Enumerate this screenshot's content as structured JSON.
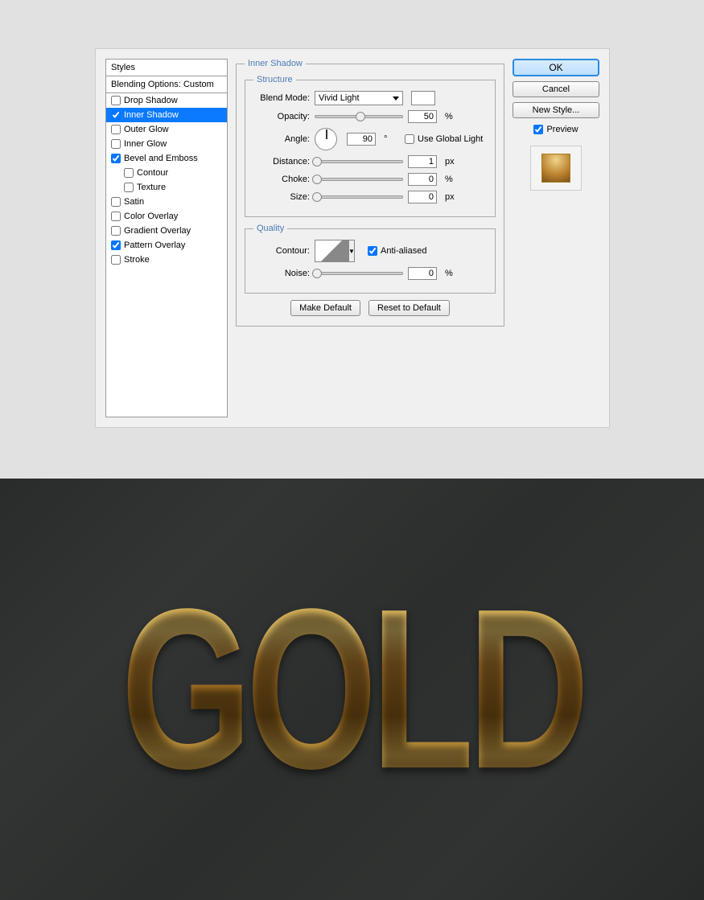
{
  "dialog": {
    "styles_header": "Styles",
    "blending_options": "Blending Options: Custom",
    "items": {
      "drop_shadow": "Drop Shadow",
      "inner_shadow": "Inner Shadow",
      "outer_glow": "Outer Glow",
      "inner_glow": "Inner Glow",
      "bevel_emboss": "Bevel and Emboss",
      "contour": "Contour",
      "texture": "Texture",
      "satin": "Satin",
      "color_overlay": "Color Overlay",
      "gradient_overlay": "Gradient Overlay",
      "pattern_overlay": "Pattern Overlay",
      "stroke": "Stroke"
    },
    "panel_title": "Inner Shadow",
    "structure": {
      "legend": "Structure",
      "blend_mode_label": "Blend Mode:",
      "blend_mode_value": "Vivid Light",
      "opacity_label": "Opacity:",
      "opacity_value": "50",
      "opacity_unit": "%",
      "angle_label": "Angle:",
      "angle_value": "90",
      "angle_unit": "°",
      "use_global_light": "Use Global Light",
      "distance_label": "Distance:",
      "distance_value": "1",
      "distance_unit": "px",
      "choke_label": "Choke:",
      "choke_value": "0",
      "choke_unit": "%",
      "size_label": "Size:",
      "size_value": "0",
      "size_unit": "px"
    },
    "quality": {
      "legend": "Quality",
      "contour_label": "Contour:",
      "anti_aliased": "Anti-aliased",
      "noise_label": "Noise:",
      "noise_value": "0",
      "noise_unit": "%"
    },
    "buttons": {
      "make_default": "Make Default",
      "reset_default": "Reset to Default",
      "ok": "OK",
      "cancel": "Cancel",
      "new_style": "New Style...",
      "preview": "Preview"
    }
  },
  "result_text": "GOLD"
}
